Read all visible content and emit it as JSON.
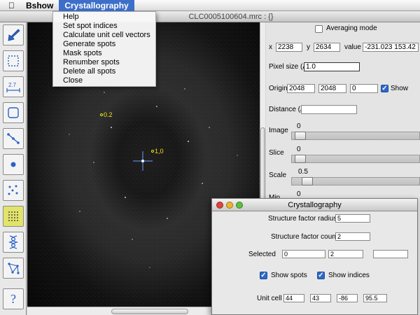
{
  "menubar": {
    "apple_icon": "apple-icon",
    "items": [
      {
        "label": "Bshow"
      },
      {
        "label": "Crystallography"
      }
    ]
  },
  "menu_crystallography": {
    "items": [
      "Help",
      "Set spot indices",
      "Calculate unit cell vectors",
      "Generate spots",
      "Mask spots",
      "Renumber spots",
      "Delete all spots",
      "Close"
    ]
  },
  "window": {
    "title": "CLC0005100604.mrc : {}"
  },
  "toolbar": {
    "tools": [
      {
        "icon": "pointer-arrow-icon",
        "selected": false
      },
      {
        "icon": "rectangle-select-icon",
        "selected": false
      },
      {
        "icon": "ruler-icon",
        "selected": false
      },
      {
        "icon": "square-select-icon",
        "selected": false
      },
      {
        "icon": "line-icon",
        "selected": false
      },
      {
        "icon": "dot-icon",
        "selected": false
      },
      {
        "icon": "scatter-points-icon",
        "selected": false
      },
      {
        "icon": "lattice-grid-icon",
        "selected": true
      },
      {
        "icon": "helix-icon",
        "selected": false
      },
      {
        "icon": "network-icon",
        "selected": false
      },
      {
        "icon": "help-question-icon",
        "selected": false
      }
    ],
    "help_glyph": "?"
  },
  "canvas": {
    "labels": [
      {
        "text": "0.2"
      },
      {
        "text": "1,0"
      }
    ]
  },
  "panel": {
    "averaging_label": "Averaging mode",
    "x_label": "x",
    "x_value": "2238",
    "y_label": "y",
    "y_value": "2634",
    "value_label": "value",
    "value_value": "-231.023 153.42",
    "pixel_size_label": "Pixel size (A)",
    "pixel_size_value": "1.0",
    "origin_label": "Origin",
    "origin_x": "2048",
    "origin_y": "2048",
    "origin_z": "0",
    "show_label": "Show",
    "distance_label": "Distance (A)",
    "distance_value": "",
    "image_label": "Image",
    "image_value": "0",
    "slice_label": "Slice",
    "slice_value": "0",
    "scale_label": "Scale",
    "scale_value": "0.5",
    "min_label": "Min",
    "min_value": "0"
  },
  "dialog": {
    "title": "Crystallography",
    "sf_radius_label": "Structure factor radius",
    "sf_radius_value": "5",
    "sf_count_label": "Structure factor count",
    "sf_count_value": "2",
    "selected_label": "Selected",
    "selected_values": [
      "0",
      "2",
      ""
    ],
    "show_spots_label": "Show spots",
    "show_indices_label": "Show indices",
    "unit_cell_label": "Unit cell",
    "unit_cell_values": [
      "44",
      "43",
      "-86",
      "95.5"
    ]
  },
  "colors": {
    "menu_highlight": "#3d6ec9",
    "annotation_yellow": "#f1e11a",
    "checkbox_blue": "#2f67c9",
    "close_red": "#e0443a",
    "minimize_yellow": "#f0b429",
    "zoom_green": "#5cc13d"
  }
}
